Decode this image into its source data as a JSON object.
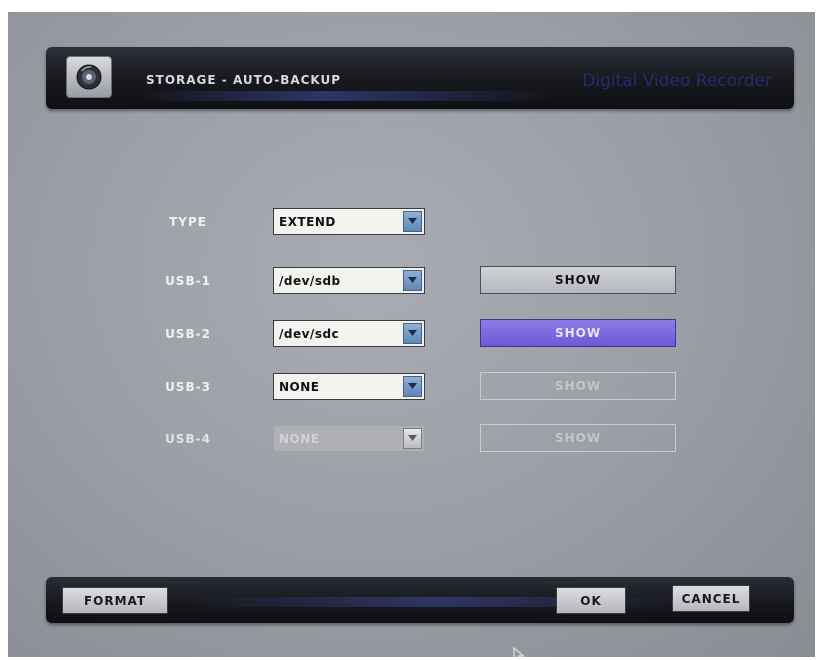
{
  "header": {
    "title": "STORAGE - AUTO-BACKUP",
    "brand": "Digital Video Recorder",
    "icon": "disk-icon"
  },
  "rows": [
    {
      "label": "TYPE",
      "value": "EXTEND",
      "disabled": false,
      "show": null
    },
    {
      "label": "USB-1",
      "value": "/dev/sdb",
      "disabled": false,
      "show": {
        "label": "SHOW",
        "state": "normal"
      }
    },
    {
      "label": "USB-2",
      "value": "/dev/sdc",
      "disabled": false,
      "show": {
        "label": "SHOW",
        "state": "active"
      }
    },
    {
      "label": "USB-3",
      "value": "NONE",
      "disabled": false,
      "show": {
        "label": "SHOW",
        "state": "disabled"
      }
    },
    {
      "label": "USB-4",
      "value": "NONE",
      "disabled": true,
      "show": {
        "label": "SHOW",
        "state": "disabled"
      }
    }
  ],
  "footer": {
    "format_label": "FORMAT",
    "ok_label": "OK",
    "cancel_label": "CANCEL"
  },
  "colors": {
    "background": "#9b9ea5",
    "bar": "#17181d",
    "dropdown_arrow": "#6f93c2",
    "show_active": "#7a64dd",
    "brand_text": "#252a6e"
  }
}
